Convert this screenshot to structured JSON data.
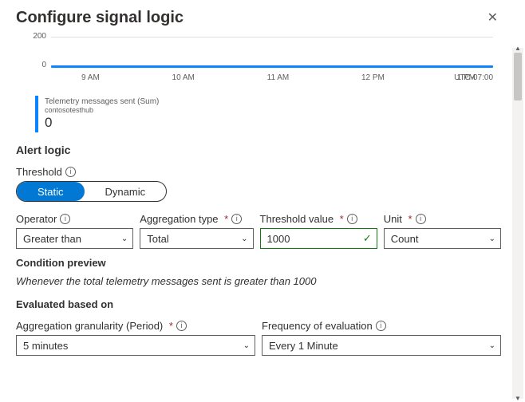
{
  "header": {
    "title": "Configure signal logic"
  },
  "chart_data": {
    "type": "line",
    "x_ticks": [
      "9 AM",
      "10 AM",
      "11 AM",
      "12 PM",
      "1 PM"
    ],
    "y_ticks": [
      0,
      200
    ],
    "ylim": [
      0,
      200
    ],
    "timezone": "UTC-07:00",
    "series": [
      {
        "name": "Telemetry messages sent (Sum)",
        "resource": "contosotesthub",
        "current_value": "0",
        "values": [
          0,
          0,
          0,
          0,
          0
        ]
      }
    ]
  },
  "alert_logic": {
    "section_title": "Alert logic",
    "threshold_label": "Threshold",
    "toggle": {
      "static": "Static",
      "dynamic": "Dynamic",
      "active": "static"
    },
    "operator": {
      "label": "Operator",
      "value": "Greater than"
    },
    "aggregation_type": {
      "label": "Aggregation type",
      "value": "Total"
    },
    "threshold_value": {
      "label": "Threshold value",
      "value": "1000"
    },
    "unit": {
      "label": "Unit",
      "value": "Count"
    }
  },
  "condition_preview": {
    "title": "Condition preview",
    "text": "Whenever the total telemetry messages sent is greater than 1000"
  },
  "evaluated": {
    "title": "Evaluated based on",
    "granularity": {
      "label": "Aggregation granularity (Period)",
      "value": "5 minutes"
    },
    "frequency": {
      "label": "Frequency of evaluation",
      "value": "Every 1 Minute"
    }
  }
}
